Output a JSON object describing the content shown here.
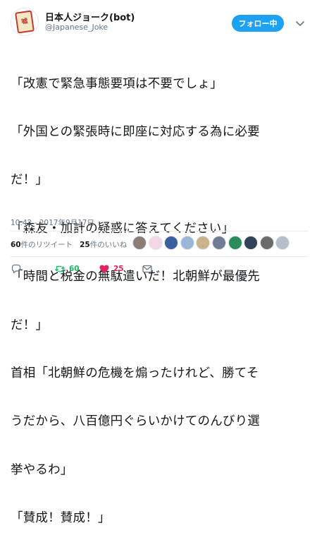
{
  "header": {
    "display_name": "日本人ジョーク(bot)",
    "handle": "@Japanese_Joke",
    "follow_label": "フォロー中",
    "avatar_text": "嘘"
  },
  "tweet": {
    "lines": [
      "「改憲で緊急事態要項は不要でしょ」",
      "「外国との緊張時に即座に対応する為に必要",
      "だ！」",
      "「森友・加計の疑惑に答えてください」",
      "「時間と税金の無駄遣いだ！北朝鮮が最優先",
      "だ！」",
      "首相「北朝鮮の危機を煽ったけれど、勝てそ",
      "うだから、八百億円ぐらいかけてのんびり選",
      "挙やるわ」",
      "「賛成！賛成！」"
    ],
    "timestamp": "10:42 - 2017年9月17日"
  },
  "stats": {
    "retweets_num": "60",
    "retweets_label": "件のリツイート",
    "likes_num": "25",
    "likes_label": "件のいいね"
  },
  "actions": {
    "reply_icon": "reply-icon",
    "retweet_count": "60",
    "like_count": "25",
    "dm_icon": "envelope-icon"
  },
  "likers": [
    {
      "color": "#8a7f75"
    },
    {
      "color": "#f4d7e4"
    },
    {
      "color": "#3b5f9c"
    },
    {
      "color": "#9bb6d6"
    },
    {
      "color": "#c9b48e"
    },
    {
      "color": "#6f7c93"
    },
    {
      "color": "#2c8a5c"
    },
    {
      "color": "#324058"
    },
    {
      "color": "#6b6b6b"
    },
    {
      "color": "#b5bec9"
    }
  ],
  "colors": {
    "accent": "#1da1f2",
    "retweet": "#17bf63",
    "like": "#e0245e",
    "muted": "#657786"
  }
}
